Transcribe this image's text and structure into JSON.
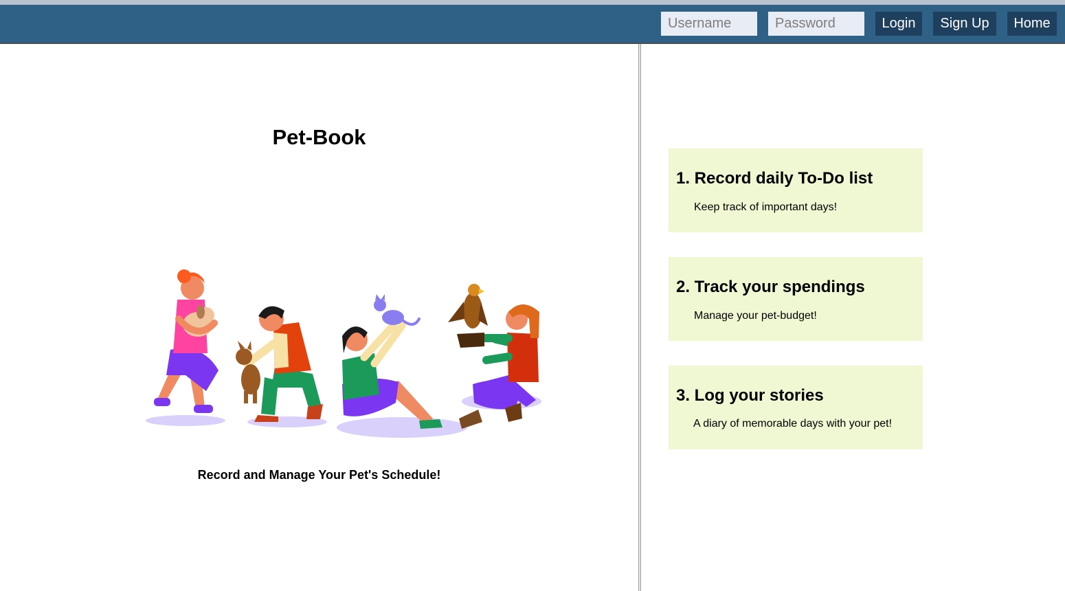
{
  "nav": {
    "username_placeholder": "Username",
    "password_placeholder": "Password",
    "login_label": "Login",
    "signup_label": "Sign Up",
    "home_label": "Home"
  },
  "hero": {
    "title": "Pet-Book",
    "tagline": "Record and Manage Your Pet's Schedule!"
  },
  "features": [
    {
      "title": "1. Record daily To-Do list",
      "description": "Keep track of important days!"
    },
    {
      "title": "2. Track your spendings",
      "description": "Manage your pet-budget!"
    },
    {
      "title": "3. Log your stories",
      "description": "A diary of memorable days with your pet!"
    }
  ],
  "colors": {
    "navbar": "#2f6187",
    "button": "#1f3f5e",
    "card": "#eff8d2"
  }
}
